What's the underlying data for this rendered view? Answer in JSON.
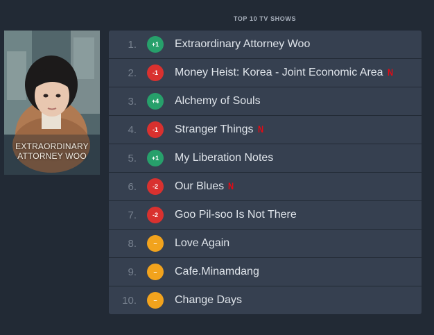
{
  "header": {
    "section_title": "TOP 10 TV SHOWS"
  },
  "poster": {
    "line1": "EXTRAORDINARY",
    "line2": "ATTORNEY WOO"
  },
  "colors": {
    "up": "#27a06b",
    "down": "#d9312f",
    "same": "#f2a31d",
    "netflix": "#e50914"
  },
  "shows": [
    {
      "rank": "1.",
      "change": "+1",
      "trend": "up",
      "title": "Extraordinary Attorney Woo",
      "netflix": false
    },
    {
      "rank": "2.",
      "change": "-1",
      "trend": "down",
      "title": "Money Heist: Korea - Joint Economic Area",
      "netflix": true
    },
    {
      "rank": "3.",
      "change": "+4",
      "trend": "up",
      "title": "Alchemy of Souls",
      "netflix": false
    },
    {
      "rank": "4.",
      "change": "-1",
      "trend": "down",
      "title": "Stranger Things",
      "netflix": true
    },
    {
      "rank": "5.",
      "change": "+1",
      "trend": "up",
      "title": "My Liberation Notes",
      "netflix": false
    },
    {
      "rank": "6.",
      "change": "-2",
      "trend": "down",
      "title": "Our Blues",
      "netflix": true
    },
    {
      "rank": "7.",
      "change": "-2",
      "trend": "down",
      "title": "Goo Pil-soo Is Not There",
      "netflix": false
    },
    {
      "rank": "8.",
      "change": "–",
      "trend": "same",
      "title": "Love Again",
      "netflix": false
    },
    {
      "rank": "9.",
      "change": "–",
      "trend": "same",
      "title": "Cafe.Minamdang",
      "netflix": false
    },
    {
      "rank": "10.",
      "change": "–",
      "trend": "same",
      "title": "Change Days",
      "netflix": false
    }
  ]
}
